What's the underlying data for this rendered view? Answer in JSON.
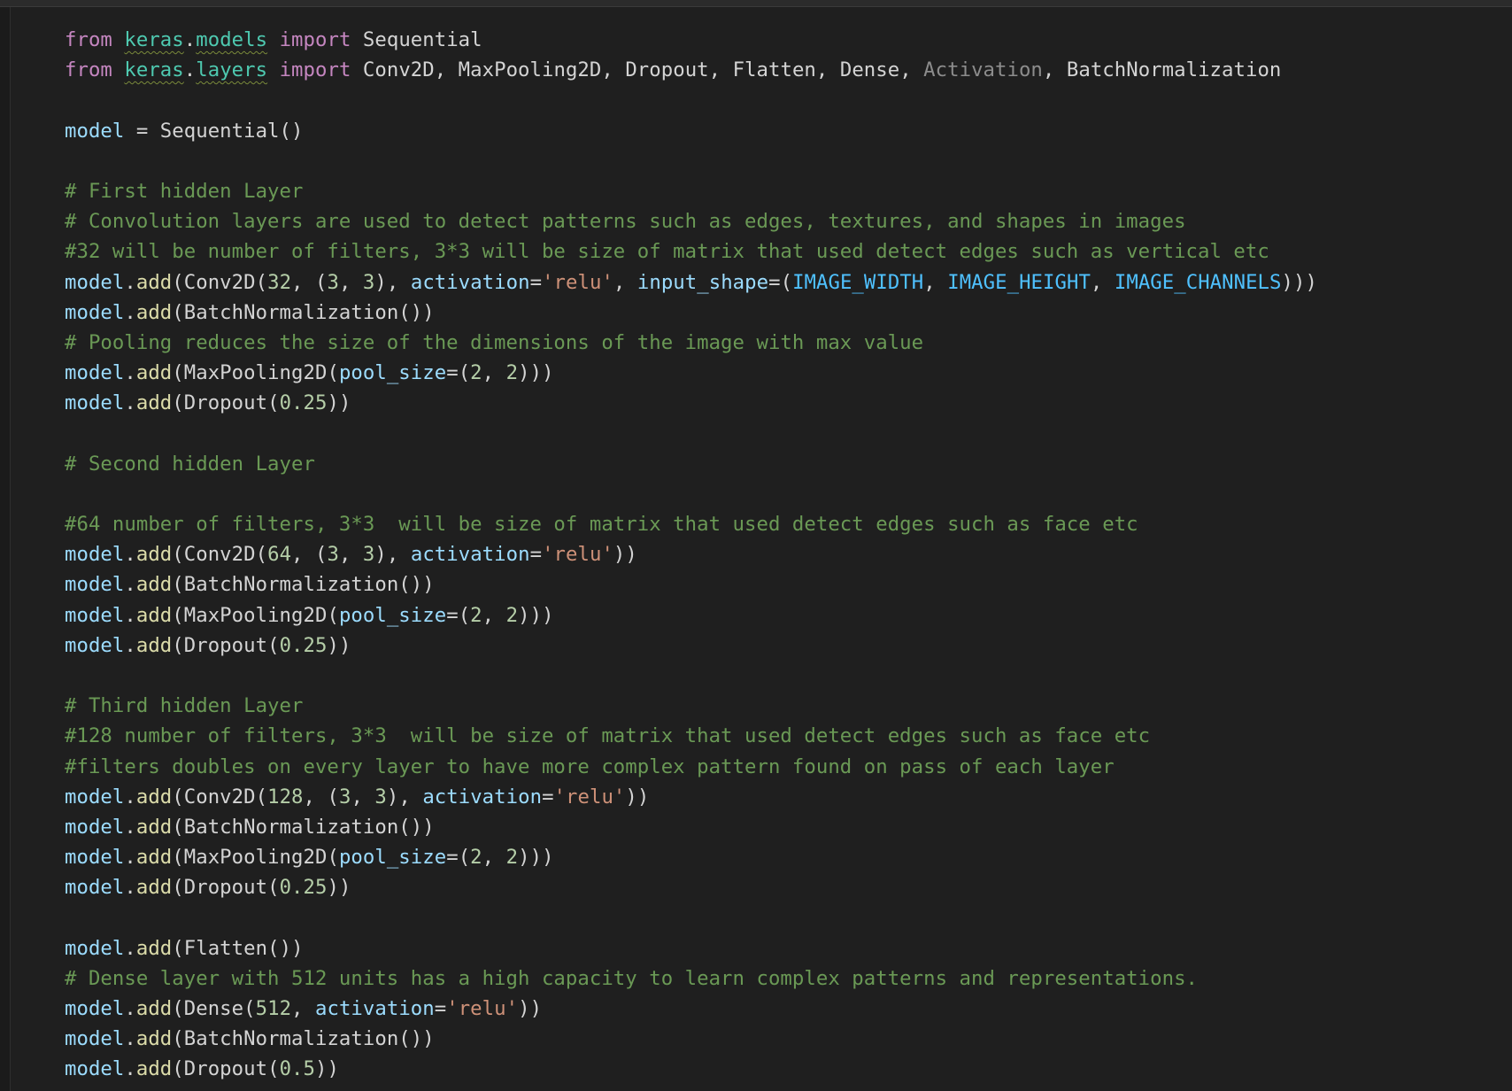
{
  "editor": {
    "language": "python",
    "lines": [
      [
        {
          "t": "from",
          "c": "kw"
        },
        {
          "t": " ",
          "c": "plain"
        },
        {
          "t": "keras",
          "c": "mod"
        },
        {
          "t": ".",
          "c": "plain"
        },
        {
          "t": "models",
          "c": "mod"
        },
        {
          "t": " ",
          "c": "plain"
        },
        {
          "t": "import",
          "c": "kw"
        },
        {
          "t": " Sequential",
          "c": "cls2"
        }
      ],
      [
        {
          "t": "from",
          "c": "kw"
        },
        {
          "t": " ",
          "c": "plain"
        },
        {
          "t": "keras",
          "c": "mod"
        },
        {
          "t": ".",
          "c": "plain"
        },
        {
          "t": "layers",
          "c": "mod"
        },
        {
          "t": " ",
          "c": "plain"
        },
        {
          "t": "import",
          "c": "kw"
        },
        {
          "t": " Conv2D, MaxPooling2D, Dropout, Flatten, Dense, ",
          "c": "cls2"
        },
        {
          "t": "Activation",
          "c": "unused"
        },
        {
          "t": ", BatchNormalization",
          "c": "cls2"
        }
      ],
      [],
      [
        {
          "t": "model",
          "c": "var"
        },
        {
          "t": " = ",
          "c": "plain"
        },
        {
          "t": "Sequential",
          "c": "cls2"
        },
        {
          "t": "(",
          "c": "b1"
        },
        {
          "t": ")",
          "c": "b1"
        }
      ],
      [],
      [
        {
          "t": "# First hidden Layer",
          "c": "cmt"
        }
      ],
      [
        {
          "t": "# Convolution layers are used to detect patterns such as edges, textures, and shapes in images",
          "c": "cmt"
        }
      ],
      [
        {
          "t": "#32 will be number of filters, 3*3 will be size of matrix that used detect edges such as vertical etc",
          "c": "cmt"
        }
      ],
      [
        {
          "t": "model",
          "c": "var"
        },
        {
          "t": ".",
          "c": "plain"
        },
        {
          "t": "add",
          "c": "fn"
        },
        {
          "t": "(",
          "c": "b1"
        },
        {
          "t": "Conv2D",
          "c": "cls2"
        },
        {
          "t": "(",
          "c": "b2"
        },
        {
          "t": "32",
          "c": "num"
        },
        {
          "t": ", ",
          "c": "plain"
        },
        {
          "t": "(",
          "c": "b3"
        },
        {
          "t": "3",
          "c": "num"
        },
        {
          "t": ", ",
          "c": "plain"
        },
        {
          "t": "3",
          "c": "num"
        },
        {
          "t": ")",
          "c": "b3"
        },
        {
          "t": ", ",
          "c": "plain"
        },
        {
          "t": "activation",
          "c": "var"
        },
        {
          "t": "=",
          "c": "plain"
        },
        {
          "t": "'relu'",
          "c": "str"
        },
        {
          "t": ", ",
          "c": "plain"
        },
        {
          "t": "input_shape",
          "c": "var"
        },
        {
          "t": "=",
          "c": "plain"
        },
        {
          "t": "(",
          "c": "b3"
        },
        {
          "t": "IMAGE_WIDTH",
          "c": "const"
        },
        {
          "t": ", ",
          "c": "plain"
        },
        {
          "t": "IMAGE_HEIGHT",
          "c": "const"
        },
        {
          "t": ", ",
          "c": "plain"
        },
        {
          "t": "IMAGE_CHANNELS",
          "c": "const"
        },
        {
          "t": ")",
          "c": "b3"
        },
        {
          "t": ")",
          "c": "b2"
        },
        {
          "t": ")",
          "c": "b1"
        }
      ],
      [
        {
          "t": "model",
          "c": "var"
        },
        {
          "t": ".",
          "c": "plain"
        },
        {
          "t": "add",
          "c": "fn"
        },
        {
          "t": "(",
          "c": "b1"
        },
        {
          "t": "BatchNormalization",
          "c": "cls2"
        },
        {
          "t": "(",
          "c": "b2"
        },
        {
          "t": ")",
          "c": "b2"
        },
        {
          "t": ")",
          "c": "b1"
        }
      ],
      [
        {
          "t": "# Pooling reduces the size of the dimensions of the image with max value",
          "c": "cmt"
        }
      ],
      [
        {
          "t": "model",
          "c": "var"
        },
        {
          "t": ".",
          "c": "plain"
        },
        {
          "t": "add",
          "c": "fn"
        },
        {
          "t": "(",
          "c": "b1"
        },
        {
          "t": "MaxPooling2D",
          "c": "cls2"
        },
        {
          "t": "(",
          "c": "b2"
        },
        {
          "t": "pool_size",
          "c": "var"
        },
        {
          "t": "=",
          "c": "plain"
        },
        {
          "t": "(",
          "c": "b3"
        },
        {
          "t": "2",
          "c": "num"
        },
        {
          "t": ", ",
          "c": "plain"
        },
        {
          "t": "2",
          "c": "num"
        },
        {
          "t": ")",
          "c": "b3"
        },
        {
          "t": ")",
          "c": "b2"
        },
        {
          "t": ")",
          "c": "b1"
        }
      ],
      [
        {
          "t": "model",
          "c": "var"
        },
        {
          "t": ".",
          "c": "plain"
        },
        {
          "t": "add",
          "c": "fn"
        },
        {
          "t": "(",
          "c": "b1"
        },
        {
          "t": "Dropout",
          "c": "cls2"
        },
        {
          "t": "(",
          "c": "b2"
        },
        {
          "t": "0.25",
          "c": "num"
        },
        {
          "t": ")",
          "c": "b2"
        },
        {
          "t": ")",
          "c": "b1"
        }
      ],
      [],
      [
        {
          "t": "# Second hidden Layer",
          "c": "cmt"
        }
      ],
      [],
      [
        {
          "t": "#64 number of filters, 3*3  will be size of matrix that used detect edges such as face etc",
          "c": "cmt"
        }
      ],
      [
        {
          "t": "model",
          "c": "var"
        },
        {
          "t": ".",
          "c": "plain"
        },
        {
          "t": "add",
          "c": "fn"
        },
        {
          "t": "(",
          "c": "b1"
        },
        {
          "t": "Conv2D",
          "c": "cls2"
        },
        {
          "t": "(",
          "c": "b2"
        },
        {
          "t": "64",
          "c": "num"
        },
        {
          "t": ", ",
          "c": "plain"
        },
        {
          "t": "(",
          "c": "b3"
        },
        {
          "t": "3",
          "c": "num"
        },
        {
          "t": ", ",
          "c": "plain"
        },
        {
          "t": "3",
          "c": "num"
        },
        {
          "t": ")",
          "c": "b3"
        },
        {
          "t": ", ",
          "c": "plain"
        },
        {
          "t": "activation",
          "c": "var"
        },
        {
          "t": "=",
          "c": "plain"
        },
        {
          "t": "'relu'",
          "c": "str"
        },
        {
          "t": ")",
          "c": "b2"
        },
        {
          "t": ")",
          "c": "b1"
        }
      ],
      [
        {
          "t": "model",
          "c": "var"
        },
        {
          "t": ".",
          "c": "plain"
        },
        {
          "t": "add",
          "c": "fn"
        },
        {
          "t": "(",
          "c": "b1"
        },
        {
          "t": "BatchNormalization",
          "c": "cls2"
        },
        {
          "t": "(",
          "c": "b2"
        },
        {
          "t": ")",
          "c": "b2"
        },
        {
          "t": ")",
          "c": "b1"
        }
      ],
      [
        {
          "t": "model",
          "c": "var"
        },
        {
          "t": ".",
          "c": "plain"
        },
        {
          "t": "add",
          "c": "fn"
        },
        {
          "t": "(",
          "c": "b1"
        },
        {
          "t": "MaxPooling2D",
          "c": "cls2"
        },
        {
          "t": "(",
          "c": "b2"
        },
        {
          "t": "pool_size",
          "c": "var"
        },
        {
          "t": "=",
          "c": "plain"
        },
        {
          "t": "(",
          "c": "b3"
        },
        {
          "t": "2",
          "c": "num"
        },
        {
          "t": ", ",
          "c": "plain"
        },
        {
          "t": "2",
          "c": "num"
        },
        {
          "t": ")",
          "c": "b3"
        },
        {
          "t": ")",
          "c": "b2"
        },
        {
          "t": ")",
          "c": "b1"
        }
      ],
      [
        {
          "t": "model",
          "c": "var"
        },
        {
          "t": ".",
          "c": "plain"
        },
        {
          "t": "add",
          "c": "fn"
        },
        {
          "t": "(",
          "c": "b1"
        },
        {
          "t": "Dropout",
          "c": "cls2"
        },
        {
          "t": "(",
          "c": "b2"
        },
        {
          "t": "0.25",
          "c": "num"
        },
        {
          "t": ")",
          "c": "b2"
        },
        {
          "t": ")",
          "c": "b1"
        }
      ],
      [],
      [
        {
          "t": "# Third hidden Layer",
          "c": "cmt"
        }
      ],
      [
        {
          "t": "#128 number of filters, 3*3  will be size of matrix that used detect edges such as face etc",
          "c": "cmt"
        }
      ],
      [
        {
          "t": "#filters doubles on every layer to have more complex pattern found on pass of each layer",
          "c": "cmt"
        }
      ],
      [
        {
          "t": "model",
          "c": "var"
        },
        {
          "t": ".",
          "c": "plain"
        },
        {
          "t": "add",
          "c": "fn"
        },
        {
          "t": "(",
          "c": "b1"
        },
        {
          "t": "Conv2D",
          "c": "cls2"
        },
        {
          "t": "(",
          "c": "b2"
        },
        {
          "t": "128",
          "c": "num"
        },
        {
          "t": ", ",
          "c": "plain"
        },
        {
          "t": "(",
          "c": "b3"
        },
        {
          "t": "3",
          "c": "num"
        },
        {
          "t": ", ",
          "c": "plain"
        },
        {
          "t": "3",
          "c": "num"
        },
        {
          "t": ")",
          "c": "b3"
        },
        {
          "t": ", ",
          "c": "plain"
        },
        {
          "t": "activation",
          "c": "var"
        },
        {
          "t": "=",
          "c": "plain"
        },
        {
          "t": "'relu'",
          "c": "str"
        },
        {
          "t": ")",
          "c": "b2"
        },
        {
          "t": ")",
          "c": "b1"
        }
      ],
      [
        {
          "t": "model",
          "c": "var"
        },
        {
          "t": ".",
          "c": "plain"
        },
        {
          "t": "add",
          "c": "fn"
        },
        {
          "t": "(",
          "c": "b1"
        },
        {
          "t": "BatchNormalization",
          "c": "cls2"
        },
        {
          "t": "(",
          "c": "b2"
        },
        {
          "t": ")",
          "c": "b2"
        },
        {
          "t": ")",
          "c": "b1"
        }
      ],
      [
        {
          "t": "model",
          "c": "var"
        },
        {
          "t": ".",
          "c": "plain"
        },
        {
          "t": "add",
          "c": "fn"
        },
        {
          "t": "(",
          "c": "b1"
        },
        {
          "t": "MaxPooling2D",
          "c": "cls2"
        },
        {
          "t": "(",
          "c": "b2"
        },
        {
          "t": "pool_size",
          "c": "var"
        },
        {
          "t": "=",
          "c": "plain"
        },
        {
          "t": "(",
          "c": "b3"
        },
        {
          "t": "2",
          "c": "num"
        },
        {
          "t": ", ",
          "c": "plain"
        },
        {
          "t": "2",
          "c": "num"
        },
        {
          "t": ")",
          "c": "b3"
        },
        {
          "t": ")",
          "c": "b2"
        },
        {
          "t": ")",
          "c": "b1"
        }
      ],
      [
        {
          "t": "model",
          "c": "var"
        },
        {
          "t": ".",
          "c": "plain"
        },
        {
          "t": "add",
          "c": "fn"
        },
        {
          "t": "(",
          "c": "b1"
        },
        {
          "t": "Dropout",
          "c": "cls2"
        },
        {
          "t": "(",
          "c": "b2"
        },
        {
          "t": "0.25",
          "c": "num"
        },
        {
          "t": ")",
          "c": "b2"
        },
        {
          "t": ")",
          "c": "b1"
        }
      ],
      [],
      [
        {
          "t": "model",
          "c": "var"
        },
        {
          "t": ".",
          "c": "plain"
        },
        {
          "t": "add",
          "c": "fn"
        },
        {
          "t": "(",
          "c": "b1"
        },
        {
          "t": "Flatten",
          "c": "cls2"
        },
        {
          "t": "(",
          "c": "b2"
        },
        {
          "t": ")",
          "c": "b2"
        },
        {
          "t": ")",
          "c": "b1"
        }
      ],
      [
        {
          "t": "# Dense layer with 512 units has a high capacity to learn complex patterns and representations.",
          "c": "cmt"
        }
      ],
      [
        {
          "t": "model",
          "c": "var"
        },
        {
          "t": ".",
          "c": "plain"
        },
        {
          "t": "add",
          "c": "fn"
        },
        {
          "t": "(",
          "c": "b1"
        },
        {
          "t": "Dense",
          "c": "cls2"
        },
        {
          "t": "(",
          "c": "b2"
        },
        {
          "t": "512",
          "c": "num"
        },
        {
          "t": ", ",
          "c": "plain"
        },
        {
          "t": "activation",
          "c": "var"
        },
        {
          "t": "=",
          "c": "plain"
        },
        {
          "t": "'relu'",
          "c": "str"
        },
        {
          "t": ")",
          "c": "b2"
        },
        {
          "t": ")",
          "c": "b1"
        }
      ],
      [
        {
          "t": "model",
          "c": "var"
        },
        {
          "t": ".",
          "c": "plain"
        },
        {
          "t": "add",
          "c": "fn"
        },
        {
          "t": "(",
          "c": "b1"
        },
        {
          "t": "BatchNormalization",
          "c": "cls2"
        },
        {
          "t": "(",
          "c": "b2"
        },
        {
          "t": ")",
          "c": "b2"
        },
        {
          "t": ")",
          "c": "b1"
        }
      ],
      [
        {
          "t": "model",
          "c": "var"
        },
        {
          "t": ".",
          "c": "plain"
        },
        {
          "t": "add",
          "c": "fn"
        },
        {
          "t": "(",
          "c": "b1"
        },
        {
          "t": "Dropout",
          "c": "cls2"
        },
        {
          "t": "(",
          "c": "b2"
        },
        {
          "t": "0.5",
          "c": "num"
        },
        {
          "t": ")",
          "c": "b2"
        },
        {
          "t": ")",
          "c": "b1"
        }
      ]
    ]
  },
  "colors": {
    "background": "#1f1f1f",
    "keyword": "#c586c0",
    "module": "#4ec9b0",
    "variable": "#9cdcfe",
    "function": "#dcdcaa",
    "number": "#b5cea8",
    "string": "#ce9178",
    "comment": "#6a9955",
    "unused_import": "#8c8c8c",
    "constant": "#4fc1ff",
    "bracket_level_1": "#ffd700",
    "bracket_level_2": "#da70d6",
    "bracket_level_3": "#179fff"
  }
}
